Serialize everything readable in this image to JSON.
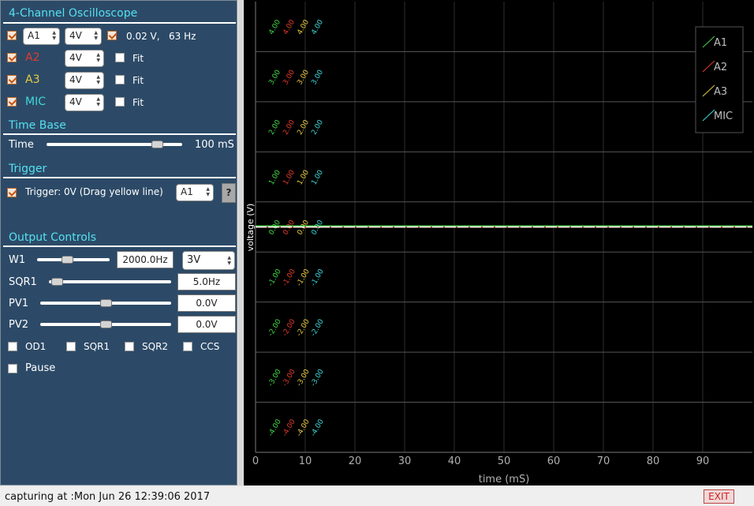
{
  "colors": {
    "panel_bg": "#2c4a67",
    "heading": "#55e0f0",
    "a1": "#44d644",
    "a2": "#e03b2f",
    "a3": "#e8cc3c",
    "mic": "#3fd8d8",
    "trace": "#ffffff",
    "grid": "#555555"
  },
  "scope": {
    "title": "4-Channel Oscilloscope",
    "ch1": {
      "name": "A1",
      "range": "4V",
      "info": "0.02 V,   63 Hz"
    },
    "ch2": {
      "name": "A2",
      "range": "4V",
      "fit": "Fit"
    },
    "ch3": {
      "name": "A3",
      "range": "4V",
      "fit": "Fit"
    },
    "ch4": {
      "name": "MIC",
      "range": "4V",
      "fit": "Fit"
    }
  },
  "timebase": {
    "title": "Time Base",
    "label": "Time",
    "value_text": "100 mS",
    "slider_fraction": 0.85
  },
  "trigger": {
    "title": "Trigger",
    "label": "Trigger: 0V (Drag yellow line)",
    "source": "A1",
    "help": "?"
  },
  "output": {
    "title": "Output Controls",
    "w1": {
      "label": "W1",
      "freq": "2000.0Hz",
      "amp": "3V",
      "slider_fraction": 0.4
    },
    "sqr1": {
      "label": "SQR1",
      "freq": "5.0Hz",
      "slider_fraction": 0.02
    },
    "pv1": {
      "label": "PV1",
      "value": "0.0V",
      "slider_fraction": 0.5
    },
    "pv2": {
      "label": "PV2",
      "value": "0.0V",
      "slider_fraction": 0.5
    },
    "checks": [
      "OD1",
      "SQR1",
      "SQR2",
      "CCS"
    ],
    "pause": "Pause"
  },
  "chart_data": {
    "type": "line",
    "xlabel": "time (mS)",
    "ylabel": "voltage (V)",
    "xlim": [
      0,
      100
    ],
    "ylim": [
      -4.5,
      4.5
    ],
    "x_ticks": [
      0,
      10,
      20,
      30,
      40,
      50,
      60,
      70,
      80,
      90
    ],
    "y_ticks": [
      "4.00",
      "3.00",
      "2.00",
      "1.00",
      "0.00",
      "-1.00",
      "-2.00",
      "-3.00",
      "-4.00"
    ],
    "series": [
      {
        "name": "A1",
        "color": "#44d644",
        "x": [
          0,
          100
        ],
        "y": [
          0.02,
          0.02
        ]
      },
      {
        "name": "A2",
        "color": "#e03b2f",
        "x": [
          0,
          100
        ],
        "y": [
          0,
          0
        ]
      },
      {
        "name": "A3",
        "color": "#e8cc3c",
        "x": [
          0,
          100
        ],
        "y": [
          0,
          0
        ]
      },
      {
        "name": "MIC",
        "color": "#3fd8d8",
        "x": [
          0,
          100
        ],
        "y": [
          0,
          0
        ]
      }
    ],
    "grid": true,
    "legend": "top-right"
  },
  "status": {
    "text": "capturing at :Mon Jun 26 12:39:06 2017",
    "exit": "EXIT"
  }
}
